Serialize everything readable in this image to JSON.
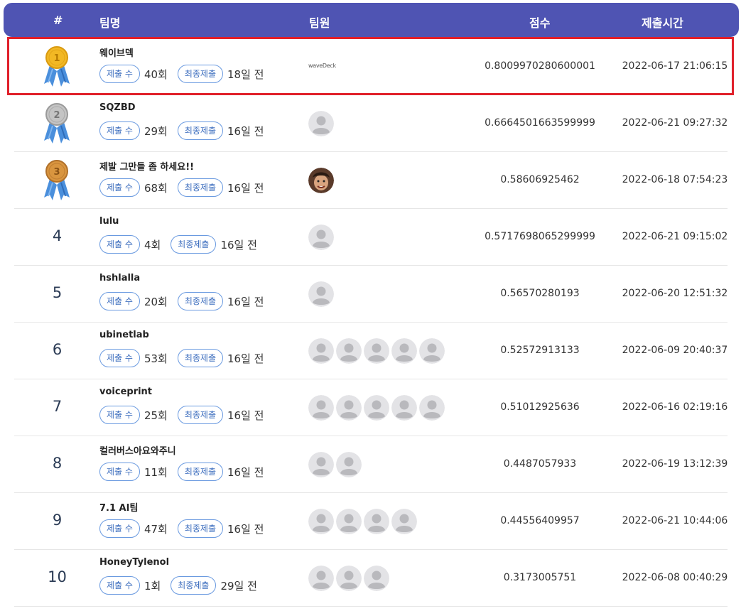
{
  "header": {
    "rank": "#",
    "team": "팀명",
    "members": "팀원",
    "score": "점수",
    "time": "제출시간"
  },
  "labels": {
    "submit_count": "제출 수",
    "last_submit": "최종제출"
  },
  "rows": [
    {
      "rank": "1",
      "medal": "gold",
      "name": "웨이브덱",
      "count": "40회",
      "ago": "18일 전",
      "logo": "waveDeck",
      "members": 0,
      "score": "0.8009970280600001",
      "time": "2022-06-17 21:06:15"
    },
    {
      "rank": "2",
      "medal": "silver",
      "name": "SQZBD",
      "count": "29회",
      "ago": "16일 전",
      "members": 1,
      "score": "0.6664501663599999",
      "time": "2022-06-21 09:27:32"
    },
    {
      "rank": "3",
      "medal": "bronze",
      "name": "제발 그만들 좀 하세요!!",
      "count": "68회",
      "ago": "16일 전",
      "members": 1,
      "photo": true,
      "score": "0.58606925462",
      "time": "2022-06-18 07:54:23"
    },
    {
      "rank": "4",
      "name": "lulu",
      "count": "4회",
      "ago": "16일 전",
      "members": 1,
      "score": "0.5717698065299999",
      "time": "2022-06-21 09:15:02"
    },
    {
      "rank": "5",
      "name": "hshlalla",
      "count": "20회",
      "ago": "16일 전",
      "members": 1,
      "score": "0.56570280193",
      "time": "2022-06-20 12:51:32"
    },
    {
      "rank": "6",
      "name": "ubinetlab",
      "count": "53회",
      "ago": "16일 전",
      "members": 5,
      "score": "0.52572913133",
      "time": "2022-06-09 20:40:37"
    },
    {
      "rank": "7",
      "name": "voiceprint",
      "count": "25회",
      "ago": "16일 전",
      "members": 5,
      "score": "0.51012925636",
      "time": "2022-06-16 02:19:16"
    },
    {
      "rank": "8",
      "name": "컬러버스아요와주니",
      "count": "11회",
      "ago": "16일 전",
      "members": 2,
      "score": "0.4487057933",
      "time": "2022-06-19 13:12:39"
    },
    {
      "rank": "9",
      "name": "7.1 AI팀",
      "count": "47회",
      "ago": "16일 전",
      "members": 4,
      "score": "0.44556409957",
      "time": "2022-06-21 10:44:06"
    },
    {
      "rank": "10",
      "name": "HoneyTylenol",
      "count": "1회",
      "ago": "29일 전",
      "members": 3,
      "score": "0.3173005751",
      "time": "2022-06-08 00:40:29"
    }
  ],
  "colors": {
    "header_bg": "#4f54b3",
    "highlight": "#e0202a",
    "pill_border": "#6a9ae0",
    "gold": "#f2b824",
    "silver": "#c4c4c4",
    "bronze": "#d9953f",
    "ribbon": "#4a8fdc"
  }
}
